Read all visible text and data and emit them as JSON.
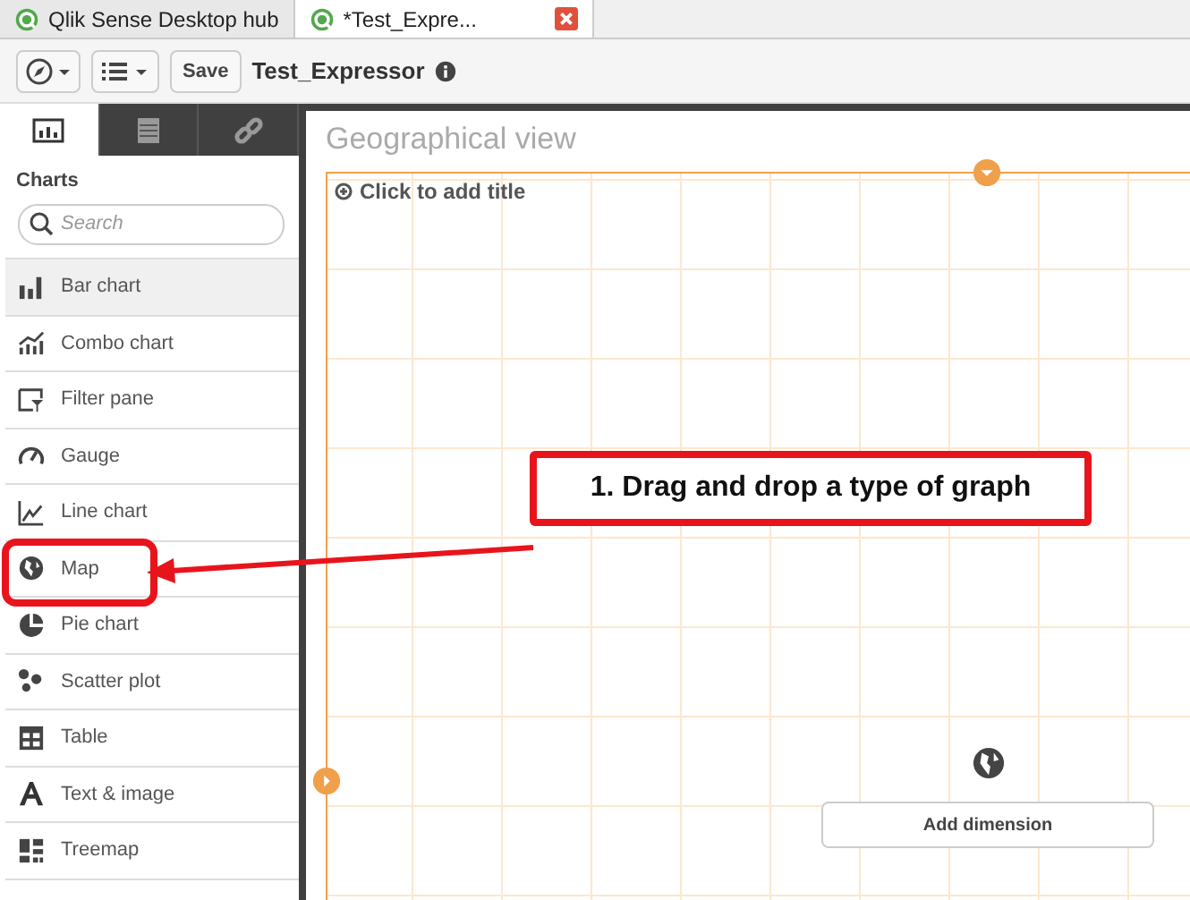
{
  "browser_tabs": [
    {
      "label": "Qlik Sense Desktop hub",
      "selected": false
    },
    {
      "label": "*Test_Expre...",
      "selected": true
    }
  ],
  "toolbar": {
    "save_label": "Save",
    "app_title": "Test_Expressor"
  },
  "sidebar": {
    "tabs": [
      {
        "selected": true
      },
      {
        "selected": false
      },
      {
        "selected": false
      }
    ],
    "heading": "Charts",
    "search": {
      "placeholder": "Search"
    },
    "items": [
      {
        "label": "Bar chart",
        "selected": true
      },
      {
        "label": "Combo chart",
        "selected": false
      },
      {
        "label": "Filter pane",
        "selected": false
      },
      {
        "label": "Gauge",
        "selected": false
      },
      {
        "label": "Line chart",
        "selected": false
      },
      {
        "label": "Map",
        "selected": false
      },
      {
        "label": "Pie chart",
        "selected": false
      },
      {
        "label": "Scatter plot",
        "selected": false
      },
      {
        "label": "Table",
        "selected": false
      },
      {
        "label": "Text & image",
        "selected": false
      },
      {
        "label": "Treemap",
        "selected": false
      }
    ]
  },
  "sheet": {
    "title": "Geographical view",
    "chart_title_placeholder": "Click to add title",
    "add_dimension": "Add dimension"
  },
  "annotation": {
    "text": "1. Drag and drop a type of graph"
  }
}
